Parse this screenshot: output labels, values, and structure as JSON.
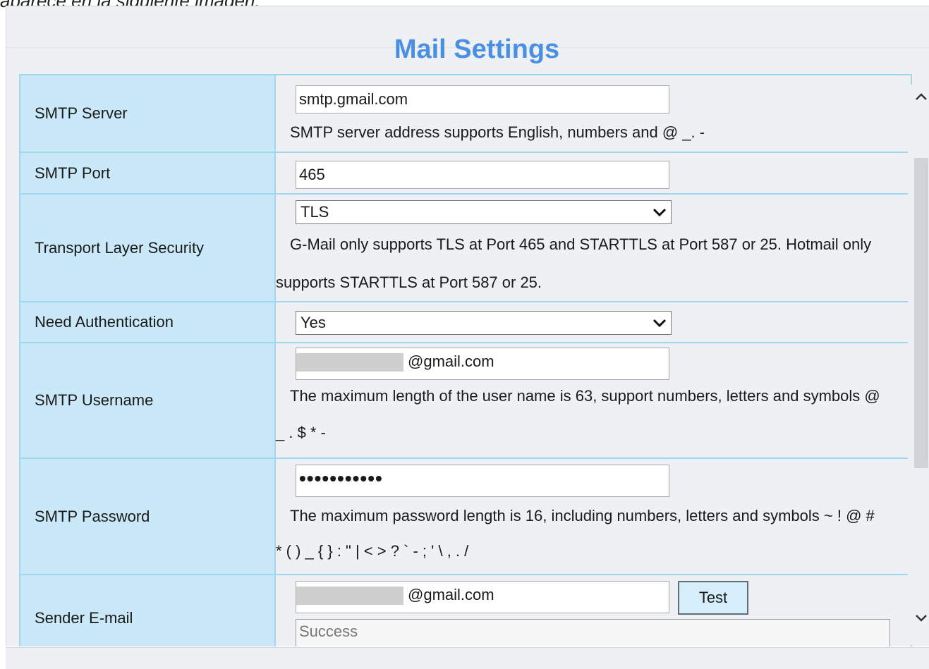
{
  "caption": "aparece en la siguiente imagen:",
  "page": {
    "title": "Mail Settings"
  },
  "rows": [
    {
      "label": "SMTP Server",
      "value": "smtp.gmail.com",
      "hint": "SMTP server address supports English, numbers and @ _. -"
    },
    {
      "label": "SMTP Port",
      "value": "465"
    },
    {
      "label": "Transport Layer Security",
      "selected": "TLS",
      "hint_line1": "G-Mail only supports TLS at Port 465 and STARTTLS at Port 587 or 25. Hotmail only",
      "hint_line2": "supports STARTTLS at Port 587 or 25."
    },
    {
      "label": "Need Authentication",
      "selected": "Yes"
    },
    {
      "label": "SMTP Username",
      "value": "@gmail.com",
      "hint_line1": "The maximum length of the user name is 63, support numbers, letters and symbols @",
      "hint_line2": "_ . $ * -"
    },
    {
      "label": "SMTP Password",
      "value": "•••••••••••",
      "hint_line1": "The maximum password length is 16, including numbers, letters and symbols ~ ! @ #",
      "hint_line2": "* ( ) _ { } : \" | < > ? ` - ; ' \\ , . /"
    },
    {
      "label": "Sender E-mail",
      "value": "@gmail.com",
      "button": "Test",
      "result": "Success"
    }
  ],
  "icons": {
    "dropdown": "chevron-down-icon",
    "scroll_up": "scroll-up-icon",
    "scroll_down": "scroll-down-icon"
  }
}
